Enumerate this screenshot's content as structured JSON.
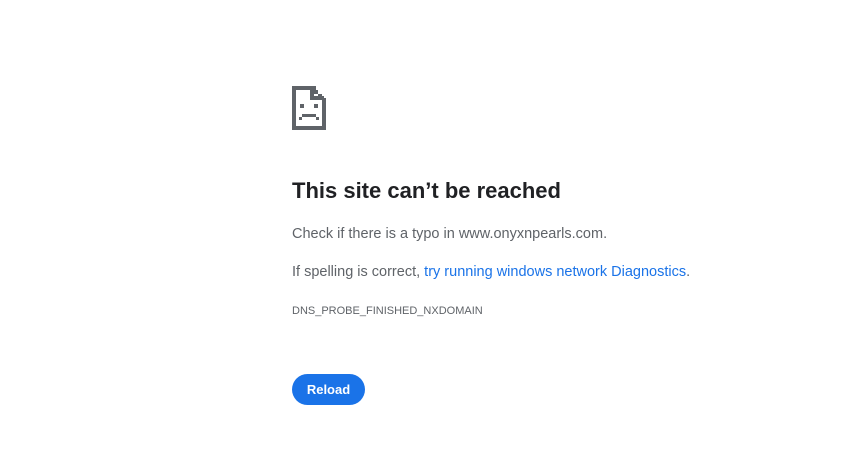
{
  "error": {
    "icon": "sad-page-icon",
    "title": "This site can’t be reached",
    "typo_message": "Check if there is a typo in www.onyxnpearls.com.",
    "spelling_prefix": "If spelling is correct, ",
    "diagnostics_link": "try running windows network Diagnostics",
    "spelling_suffix": ".",
    "code": "DNS_PROBE_FINISHED_NXDOMAIN"
  },
  "actions": {
    "reload_label": "Reload"
  },
  "colors": {
    "accent": "#1a73e8",
    "title": "#202124",
    "body_text": "#5f6368",
    "background": "#ffffff"
  }
}
